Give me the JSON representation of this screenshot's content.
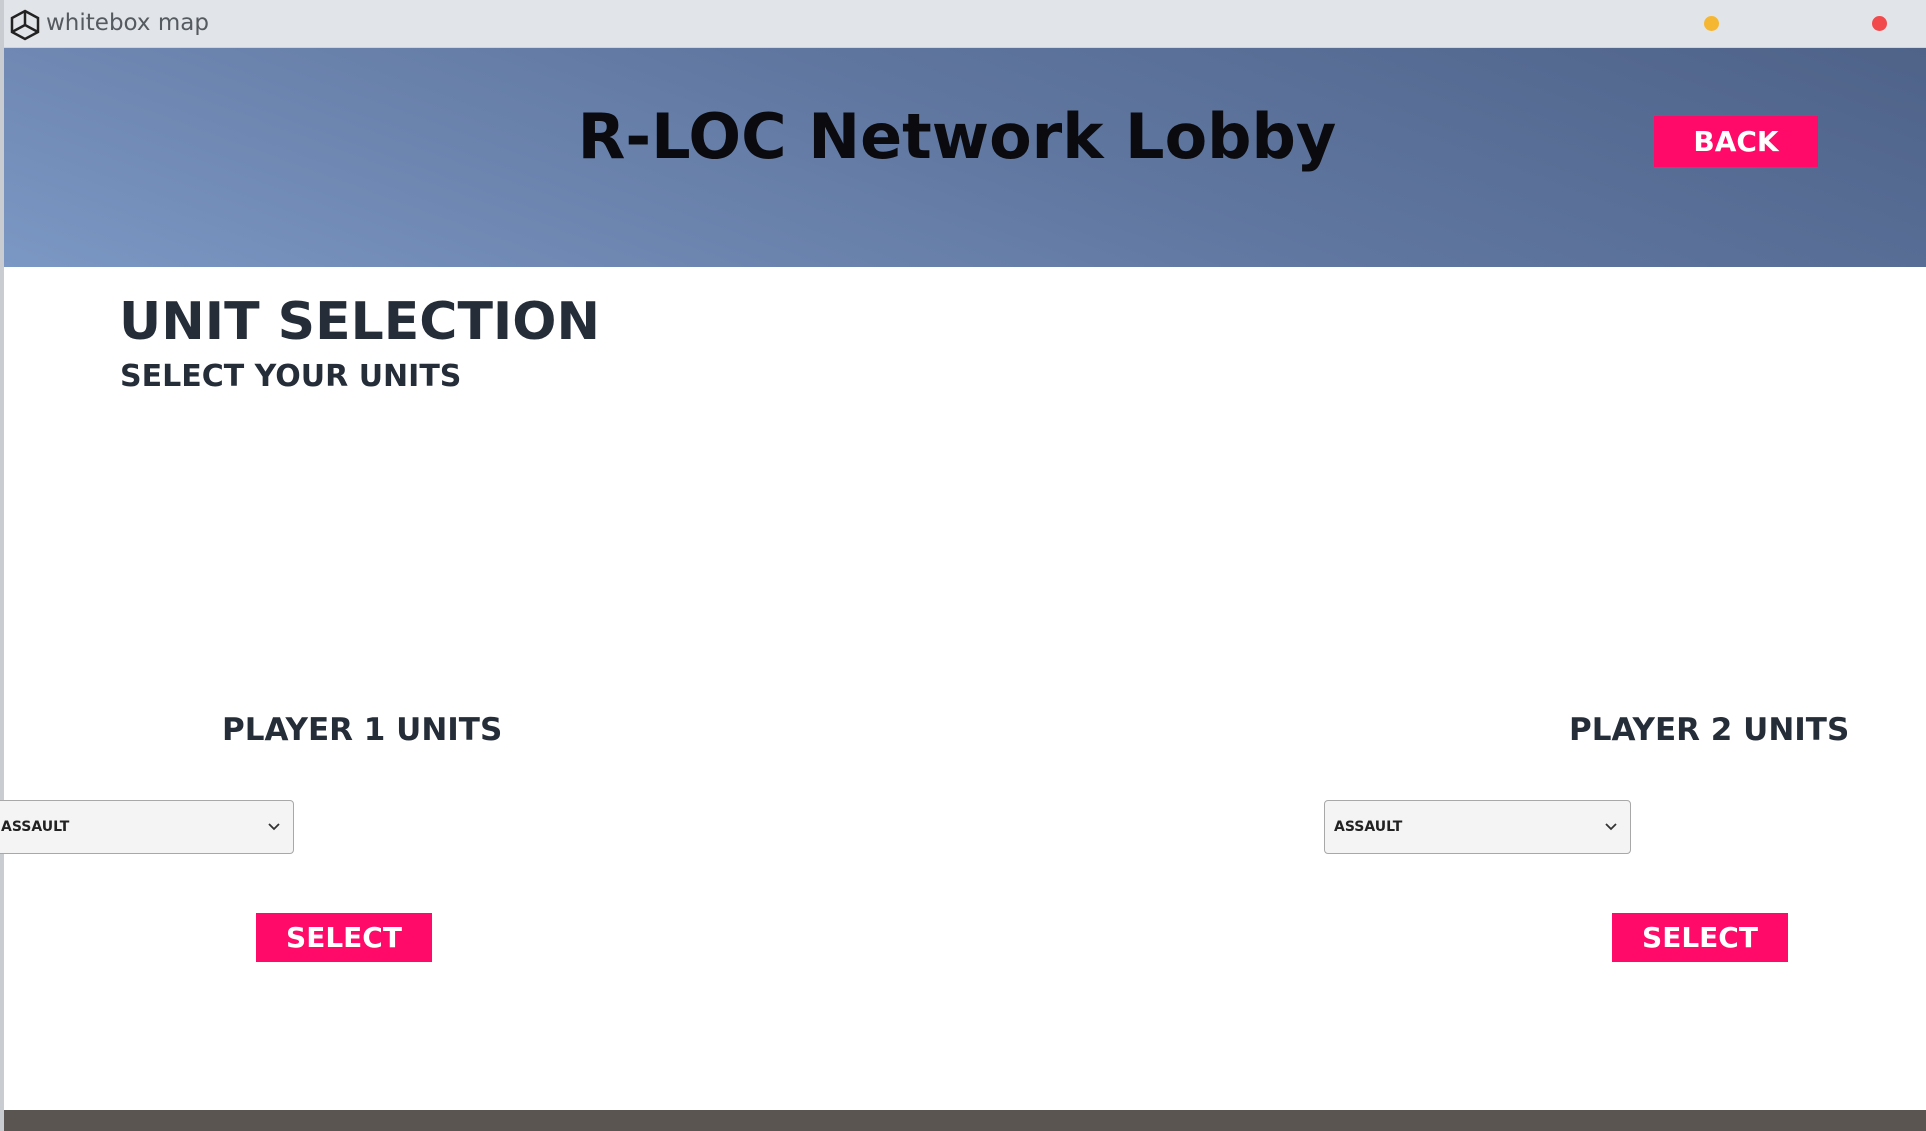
{
  "window": {
    "title": "whitebox map",
    "icon": "unity-logo-icon",
    "controls": {
      "minimize_color": "#f5b731",
      "close_color": "#f2494c"
    }
  },
  "header": {
    "title": "R-LOC Network Lobby",
    "back_label": "BACK",
    "accent": "#ff0a69"
  },
  "unit_selection": {
    "heading": "UNIT SELECTION",
    "subheading": "SELECT YOUR UNITS"
  },
  "players": [
    {
      "label": "PLAYER 1 UNITS",
      "selected_unit": "ASSAULT",
      "select_label": "SELECT"
    },
    {
      "label": "PLAYER 2 UNITS",
      "selected_unit": "ASSAULT",
      "select_label": "SELECT"
    }
  ]
}
